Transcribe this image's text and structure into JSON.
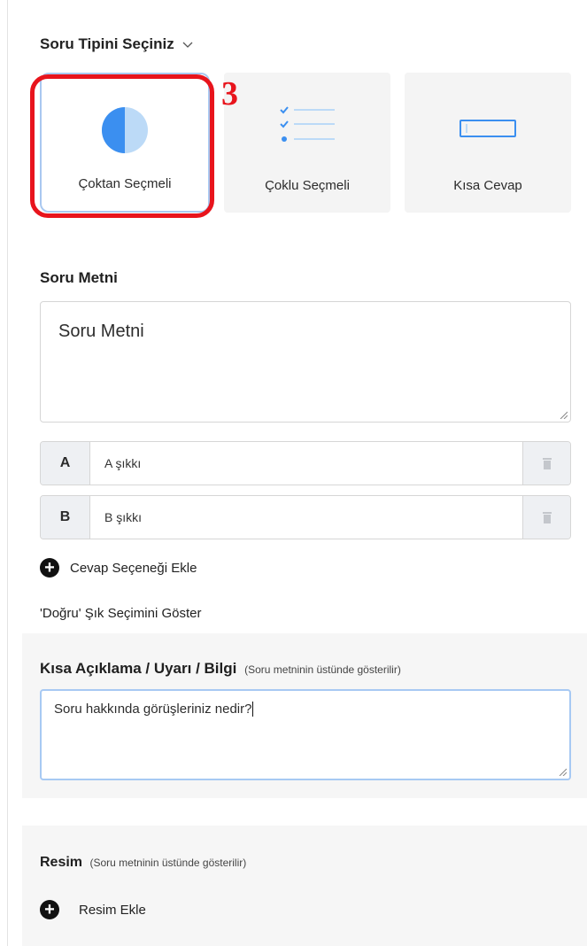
{
  "question_type": {
    "header": "Soru Tipini Seçiniz",
    "options": [
      {
        "label": "Çoktan Seçmeli",
        "icon": "half-circle-icon",
        "selected": true
      },
      {
        "label": "Çoklu Seçmeli",
        "icon": "checklist-icon",
        "selected": false
      },
      {
        "label": "Kısa Cevap",
        "icon": "input-box-icon",
        "selected": false
      }
    ]
  },
  "annotation": {
    "step": "3",
    "color": "#e8141c"
  },
  "question": {
    "label": "Soru Metni",
    "placeholder": "Soru Metni"
  },
  "answers": [
    {
      "letter": "A",
      "placeholder": "A şıkkı"
    },
    {
      "letter": "B",
      "placeholder": "B şıkkı"
    }
  ],
  "add_answer_label": "Cevap Seçeneği Ekle",
  "show_correct_label": "'Doğru' Şık Seçimini Göster",
  "info": {
    "title": "Kısa Açıklama / Uyarı / Bilgi",
    "hint": "(Soru metninin üstünde gösterilir)",
    "value": "Soru hakkında görüşleriniz nedir?"
  },
  "image": {
    "title": "Resim",
    "hint": "(Soru metninin üstünde gösterilir)",
    "add_label": "Resim Ekle"
  },
  "colors": {
    "accent_blue": "#3b8ff0",
    "highlight_red": "#e8141c"
  }
}
